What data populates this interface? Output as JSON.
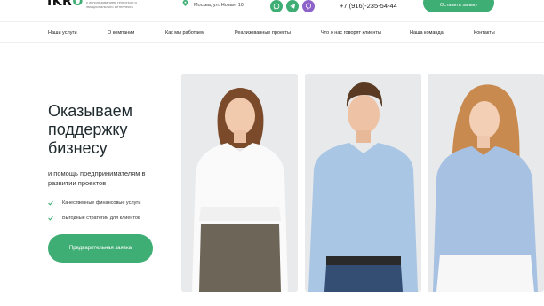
{
  "header": {
    "logo_text_main": "IKR",
    "logo_text_accent": "O",
    "tagline": "с использованием телесного и эмоционального интеллекта",
    "address": "Москва, ул. Новая, 10",
    "phone": "+7 (916)-235-54-44",
    "cta_label": "Оставить заявку",
    "social": [
      {
        "name": "whatsapp",
        "color": "#3fae74"
      },
      {
        "name": "telegram",
        "color": "#3fae74"
      },
      {
        "name": "viber",
        "color": "#8e63c9"
      }
    ]
  },
  "nav": {
    "items": [
      "Наши услуги",
      "О компании",
      "Как мы работаем",
      "Реализованные проекты",
      "Что о нас говорят клиенты",
      "Наша команда",
      "Контакты"
    ]
  },
  "hero": {
    "title": "Оказываем поддержку бизнесу",
    "subtitle": "и помощь предпринимателям в развитии проектов",
    "features": [
      "Качественные финансовые услуги",
      "Выгодные стратегии для клиентов"
    ],
    "cta_label": "Предварительная заявка"
  },
  "colors": {
    "accent": "#3fae74",
    "viber": "#8e63c9"
  }
}
